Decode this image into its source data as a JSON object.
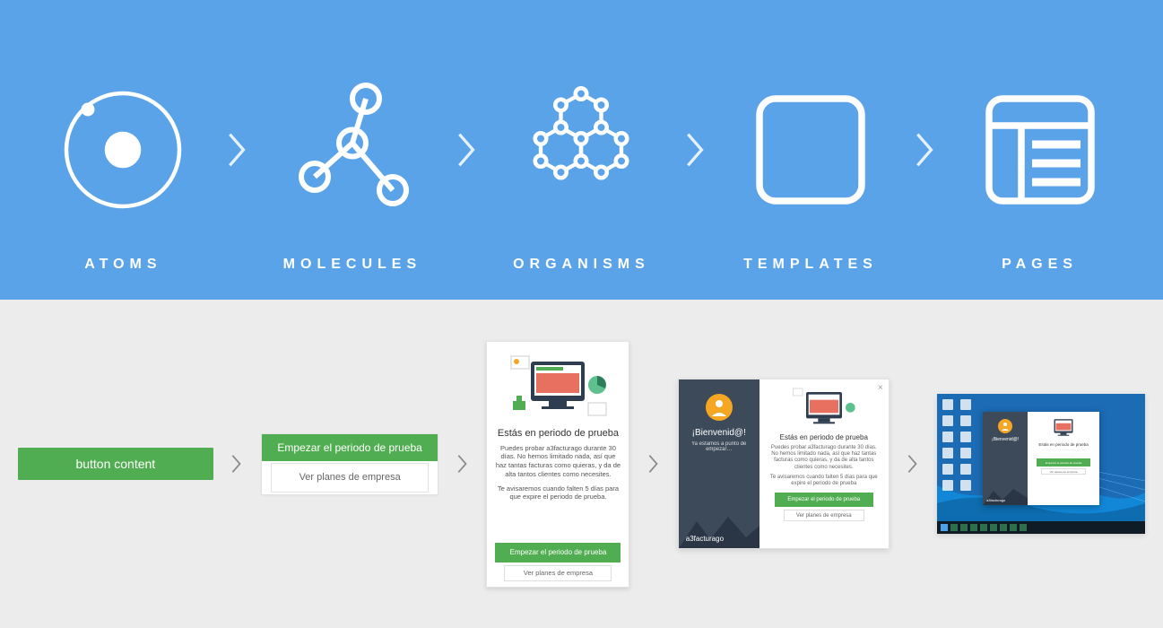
{
  "colors": {
    "blue": "#5aa3e8",
    "green": "#51ad51",
    "grey": "#ececec",
    "darkblue": "#3c4a5a"
  },
  "top": {
    "items": [
      {
        "label": "ATOMS",
        "icon": "atom-icon"
      },
      {
        "label": "MOLECULES",
        "icon": "molecule-icon"
      },
      {
        "label": "ORGANISMS",
        "icon": "organism-icon"
      },
      {
        "label": "TEMPLATES",
        "icon": "template-icon"
      },
      {
        "label": "PAGES",
        "icon": "page-icon"
      }
    ]
  },
  "atom": {
    "button_label": "button content"
  },
  "molecule": {
    "primary": "Empezar el periodo de prueba",
    "secondary": "Ver planes de empresa"
  },
  "organism": {
    "title": "Estás en periodo de prueba",
    "p1": "Puedes probar a3facturago durante 30 días. No hemos limitado nada, así que haz tantas facturas como quieras, y da de alta tantos clientes como necesites.",
    "p2": "Te avisaremos cuando falten 5 días para que expire el periodo de prueba.",
    "primary": "Empezar el periodo de prueba",
    "secondary": "Ver planes de empresa"
  },
  "template": {
    "welcome_title": "¡Bienvenid@!",
    "welcome_sub": "Ya estamos a punto de empezar…",
    "brand": "a3facturago",
    "title": "Estás en periodo de prueba",
    "p1": "Puedes probar a3facturago durante 30 días. No hemos limitado nada, así que haz tantas facturas como quieras, y da de alta tantos clientes como necesites.",
    "p2": "Te avisaremos cuando falten 5 días para que expire el periodo de prueba",
    "primary": "Empezar el periodo de prueba",
    "secondary": "Ver planes de empresa",
    "close": "×"
  },
  "page": {
    "welcome_title": "¡Bienvenid@!",
    "title": "Estás en periodo de prueba"
  }
}
